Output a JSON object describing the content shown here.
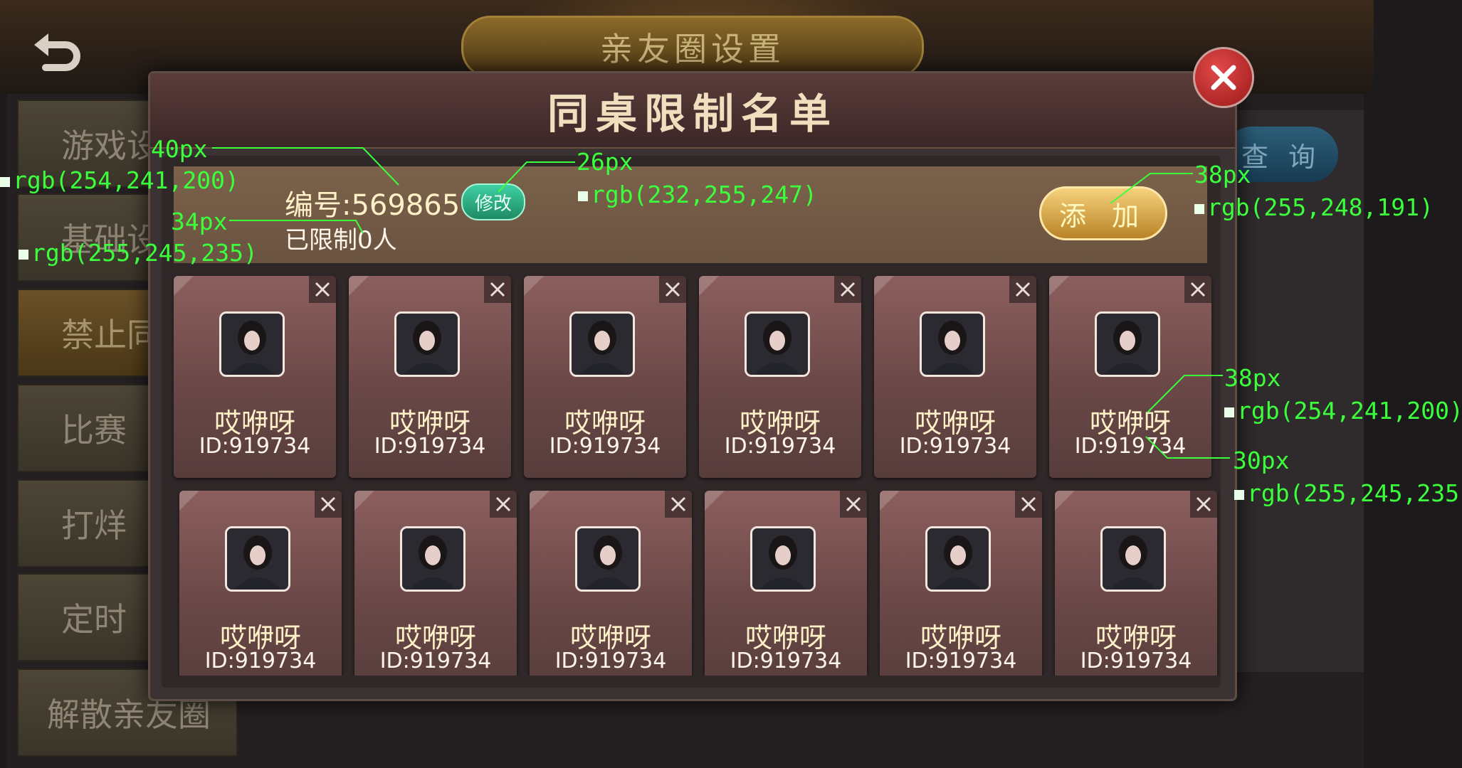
{
  "background": {
    "page_title": "亲友圈设置",
    "search_label": "查 询",
    "menu_items": [
      "游戏设",
      "基础设",
      "禁止同",
      "比赛",
      "打烊",
      "定时",
      "解散亲友圈"
    ]
  },
  "dialog": {
    "title": "同桌限制名单",
    "id_text": "编号:569865",
    "edit_label": "修改",
    "limited_text": "已限制0人",
    "add_label": "添 加"
  },
  "cards": [
    {
      "name": "哎咿呀",
      "id": "ID:919734"
    },
    {
      "name": "哎咿呀",
      "id": "ID:919734"
    },
    {
      "name": "哎咿呀",
      "id": "ID:919734"
    },
    {
      "name": "哎咿呀",
      "id": "ID:919734"
    },
    {
      "name": "哎咿呀",
      "id": "ID:919734"
    },
    {
      "name": "哎咿呀",
      "id": "ID:919734"
    },
    {
      "name": "哎咿呀",
      "id": "ID:919734"
    },
    {
      "name": "哎咿呀",
      "id": "ID:919734"
    },
    {
      "name": "哎咿呀",
      "id": "ID:919734"
    },
    {
      "name": "哎咿呀",
      "id": "ID:919734"
    },
    {
      "name": "哎咿呀",
      "id": "ID:919734"
    },
    {
      "name": "哎咿呀",
      "id": "ID:919734"
    }
  ],
  "annotations": [
    {
      "size": "40px",
      "color": "rgb(254,241,200)"
    },
    {
      "size": "34px",
      "color": "rgb(255,245,235)"
    },
    {
      "size": "26px",
      "color": "rgb(232,255,247)"
    },
    {
      "size": "38px",
      "color": "rgb(255,248,191)"
    },
    {
      "size": "38px",
      "color": "rgb(254,241,200)"
    },
    {
      "size": "30px",
      "color": "rgb(255,245,235)"
    }
  ],
  "colors": {
    "accent_gold": "#f6d17c",
    "edit_green": "#3fd0a4",
    "close_red": "#c62c2c",
    "annotation_green": "#3cff3c"
  }
}
